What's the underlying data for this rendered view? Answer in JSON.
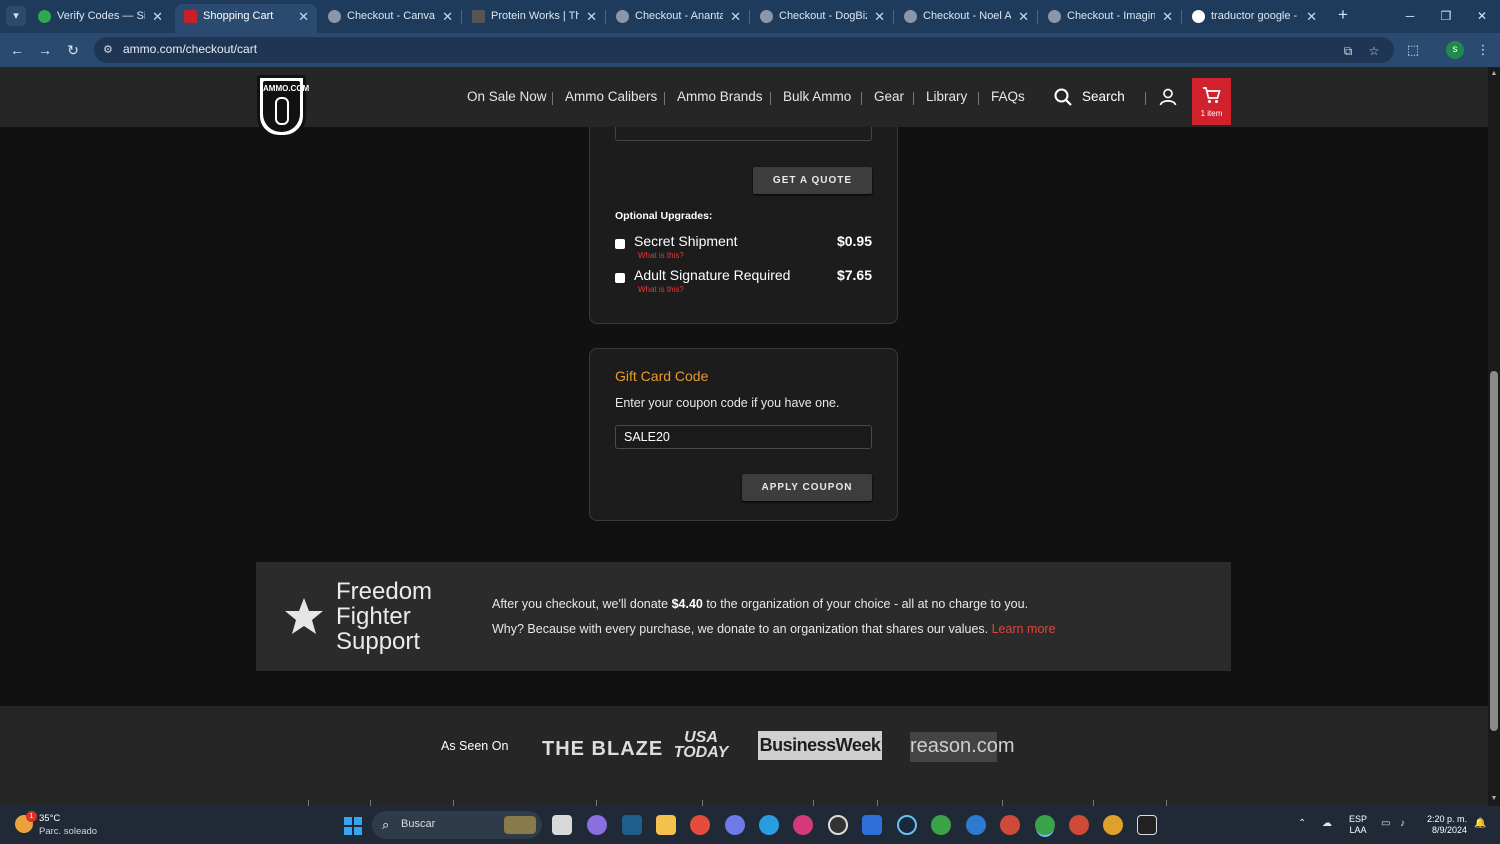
{
  "browser": {
    "tabs": [
      {
        "title": "Verify Codes — Simpl",
        "active": false
      },
      {
        "title": "Shopping Cart",
        "active": true
      },
      {
        "title": "Checkout - Canvas St",
        "active": false
      },
      {
        "title": "Protein Works | The B",
        "active": false
      },
      {
        "title": "Checkout - Ananta St",
        "active": false
      },
      {
        "title": "Checkout - DogBiznu",
        "active": false
      },
      {
        "title": "Checkout - Noel Asm",
        "active": false
      },
      {
        "title": "Checkout - Imaginary",
        "active": false
      },
      {
        "title": "traductor google - Bu",
        "active": false
      }
    ],
    "url": "ammo.com/checkout/cart",
    "profile_initial": "s"
  },
  "site": {
    "logo_text": "AMMO.COM",
    "nav": [
      "On Sale Now",
      "Ammo Calibers",
      "Ammo Brands",
      "Bulk Ammo",
      "Gear",
      "Library",
      "FAQs"
    ],
    "search_label": "Search",
    "cart_count": "1 item",
    "accent_color": "#d0212d"
  },
  "shipping": {
    "quote_button": "GET A QUOTE",
    "upgrades_title": "Optional Upgrades:",
    "upgrades": [
      {
        "name": "Secret Shipment",
        "help": "What is this?",
        "price": "$0.95"
      },
      {
        "name": "Adult Signature Required",
        "help": "What is this?",
        "price": "$7.65"
      }
    ]
  },
  "gift": {
    "title": "Gift Card Code",
    "description": "Enter your coupon code if you have one.",
    "coupon_value": "SALE20",
    "apply_button": "APPLY COUPON"
  },
  "freedom": {
    "title": "Freedom Fighter Support",
    "line1_pre": "After you checkout, we'll donate ",
    "amount": "$4.40",
    "line1_post": " to the organization of your choice - all at no charge to you.",
    "line2": "Why? Because with every purchase, we donate to an organization that shares our values.",
    "learn_more": "Learn more"
  },
  "as_seen_on": {
    "label": "As Seen On",
    "logos": [
      "THE BLAZE",
      "USA TODAY",
      "BusinessWeek",
      "reason.com"
    ]
  },
  "taskbar": {
    "weather_temp": "35°C",
    "weather_desc": "Parc. soleado",
    "weather_badge": "1",
    "search_placeholder": "Buscar",
    "lang_top": "ESP",
    "lang_bottom": "LAA",
    "time": "2:20 p. m.",
    "date": "8/9/2024"
  }
}
